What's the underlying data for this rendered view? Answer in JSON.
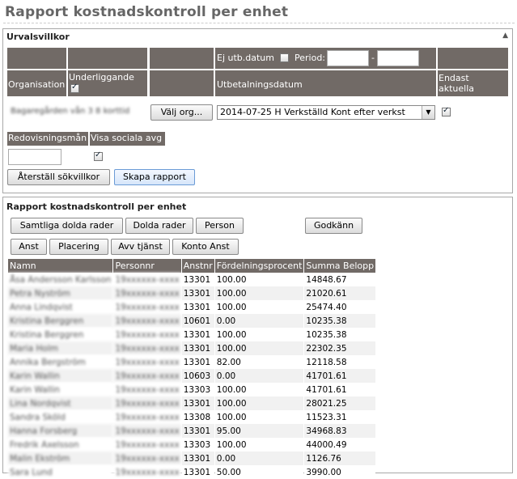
{
  "page": {
    "title": "Rapport kostnadskontroll per enhet"
  },
  "filters": {
    "section_title": "Urvalsvillkor",
    "ej_utb_datum_label": "Ej utb.datum",
    "ej_utb_datum_checked": false,
    "period_label": "Period:",
    "period_from": "",
    "period_to": "",
    "period_separator": "-",
    "organisation_label": "Organisation",
    "underliggande_label": "Underliggande",
    "underliggande_checked": true,
    "utbetalningsdatum_label": "Utbetalningsdatum",
    "endast_aktuella_label": "Endast aktuella",
    "endast_aktuella_checked": true,
    "organisation_value": "Bagaregården vån 3 8 korttid",
    "valj_org_button": "Välj org...",
    "utbetalningsdatum_value": "2014-07-25 H Verkställd Kont efter verkst",
    "redovisningsman_label": "Redovisningsmån",
    "visa_sociala_label": "Visa sociala avg",
    "redovisningsman_value": "",
    "visa_sociala_checked": true,
    "reset_button": "Återställ sökvillkor",
    "create_button": "Skapa rapport"
  },
  "report": {
    "section_title": "Rapport kostnadskontroll per enhet",
    "buttons_row1": [
      "Samtliga dolda rader",
      "Dolda rader",
      "Person"
    ],
    "approve_button": "Godkänn",
    "buttons_row2": [
      "Anst",
      "Placering",
      "Avv tjänst",
      "Konto Anst"
    ],
    "columns": [
      "Namn",
      "Personnr",
      "Anstnr",
      "Fördelningsprocent",
      "Summa Belopp"
    ],
    "rows": [
      {
        "namn": "Åsa Andersson Karlsson",
        "personnr": "19xxxxxx-xxxx",
        "anstnr": "13301",
        "fordelning": "100.00",
        "summa": "14848.67"
      },
      {
        "namn": "Petra Nyström",
        "personnr": "19xxxxxx-xxxx",
        "anstnr": "13301",
        "fordelning": "100.00",
        "summa": "21020.61"
      },
      {
        "namn": "Anna Lindqvist",
        "personnr": "19xxxxxx-xxxx",
        "anstnr": "13301",
        "fordelning": "100.00",
        "summa": "25474.40"
      },
      {
        "namn": "Kristina Berggren",
        "personnr": "19xxxxxx-xxxx",
        "anstnr": "10601",
        "fordelning": "0.00",
        "summa": "10235.38"
      },
      {
        "namn": "Kristina Berggren",
        "personnr": "19xxxxxx-xxxx",
        "anstnr": "13301",
        "fordelning": "100.00",
        "summa": "10235.38"
      },
      {
        "namn": "Maria Holm",
        "personnr": "19xxxxxx-xxxx",
        "anstnr": "13301",
        "fordelning": "100.00",
        "summa": "22302.35"
      },
      {
        "namn": "Annika Bergström",
        "personnr": "19xxxxxx-xxxx",
        "anstnr": "13301",
        "fordelning": "82.00",
        "summa": "12118.58"
      },
      {
        "namn": "Karin Wallin",
        "personnr": "19xxxxxx-xxxx",
        "anstnr": "10603",
        "fordelning": "0.00",
        "summa": "41701.61"
      },
      {
        "namn": "Karin Wallin",
        "personnr": "19xxxxxx-xxxx",
        "anstnr": "13303",
        "fordelning": "100.00",
        "summa": "41701.61"
      },
      {
        "namn": "Lina Nordqvist",
        "personnr": "19xxxxxx-xxxx",
        "anstnr": "13301",
        "fordelning": "100.00",
        "summa": "28021.25"
      },
      {
        "namn": "Sandra Sköld",
        "personnr": "19xxxxxx-xxxx",
        "anstnr": "13308",
        "fordelning": "100.00",
        "summa": "11523.31"
      },
      {
        "namn": "Hanna Forsberg",
        "personnr": "19xxxxxx-xxxx",
        "anstnr": "13301",
        "fordelning": "95.00",
        "summa": "34968.83"
      },
      {
        "namn": "Fredrik Axelsson",
        "personnr": "19xxxxxx-xxxx",
        "anstnr": "13303",
        "fordelning": "100.00",
        "summa": "44000.49"
      },
      {
        "namn": "Malin Ekström",
        "personnr": "19xxxxxx-xxxx",
        "anstnr": "13301",
        "fordelning": "0.00",
        "summa": "1126.76"
      },
      {
        "namn": "Sara Lund",
        "personnr": "19xxxxxx-xxxx",
        "anstnr": "13301",
        "fordelning": "50.00",
        "summa": "3990.00"
      }
    ]
  },
  "colors": {
    "header_bg": "#716a66",
    "title_color": "#666666"
  }
}
